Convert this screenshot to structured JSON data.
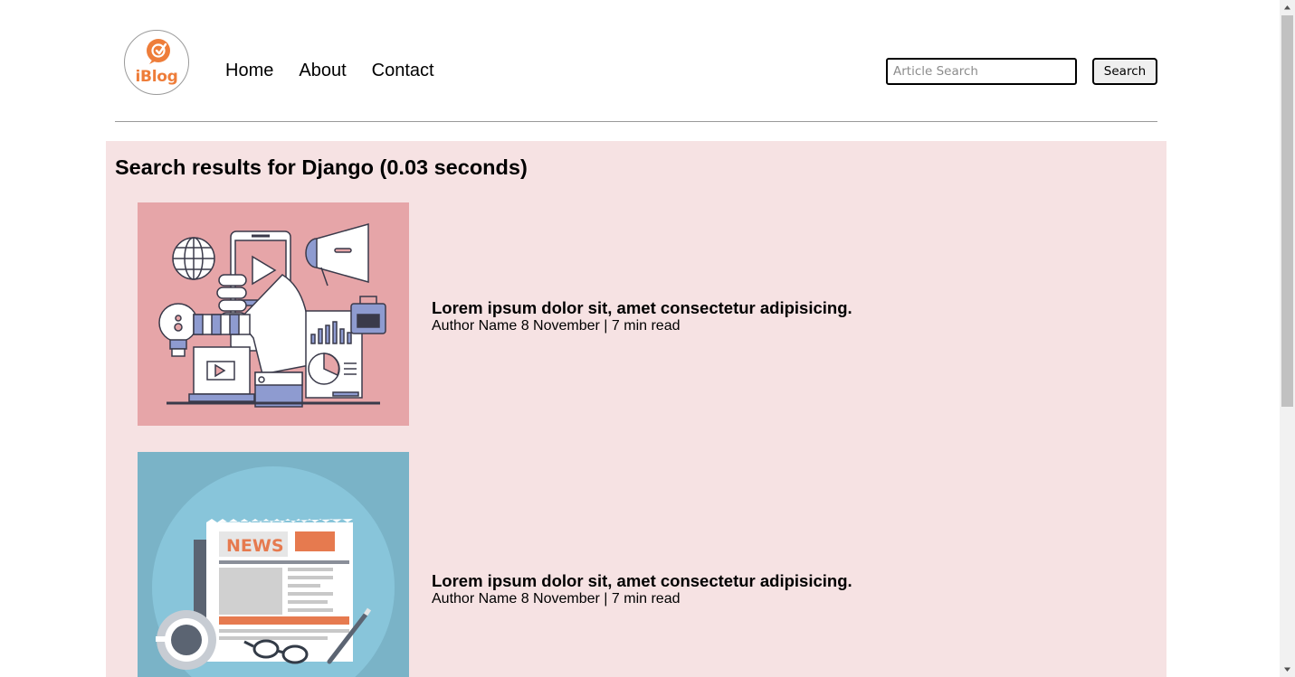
{
  "header": {
    "logo_text": "iBlog",
    "nav": [
      "Home",
      "About",
      "Contact"
    ],
    "search": {
      "placeholder": "Article Search",
      "value": "",
      "button_label": "Search"
    }
  },
  "results": {
    "heading": "Search results for Django (0.03 seconds)",
    "articles": [
      {
        "title": "Lorem ipsum dolor sit, amet consectetur adipisicing.",
        "meta": "Author Name 8 November | 7 min read",
        "image": "digital-marketing-illustration"
      },
      {
        "title": "Lorem ipsum dolor sit, amet consectetur adipisicing.",
        "meta": "Author Name 8 November | 7 min read",
        "image": "newspaper-illustration",
        "image_text": "NEWS"
      }
    ]
  },
  "colors": {
    "panel_bg": "#f6e2e3",
    "accent_orange": "#ee7d3a",
    "thumb1_bg": "#e6a5a8",
    "thumb2_bg": "#7ab3c7"
  }
}
